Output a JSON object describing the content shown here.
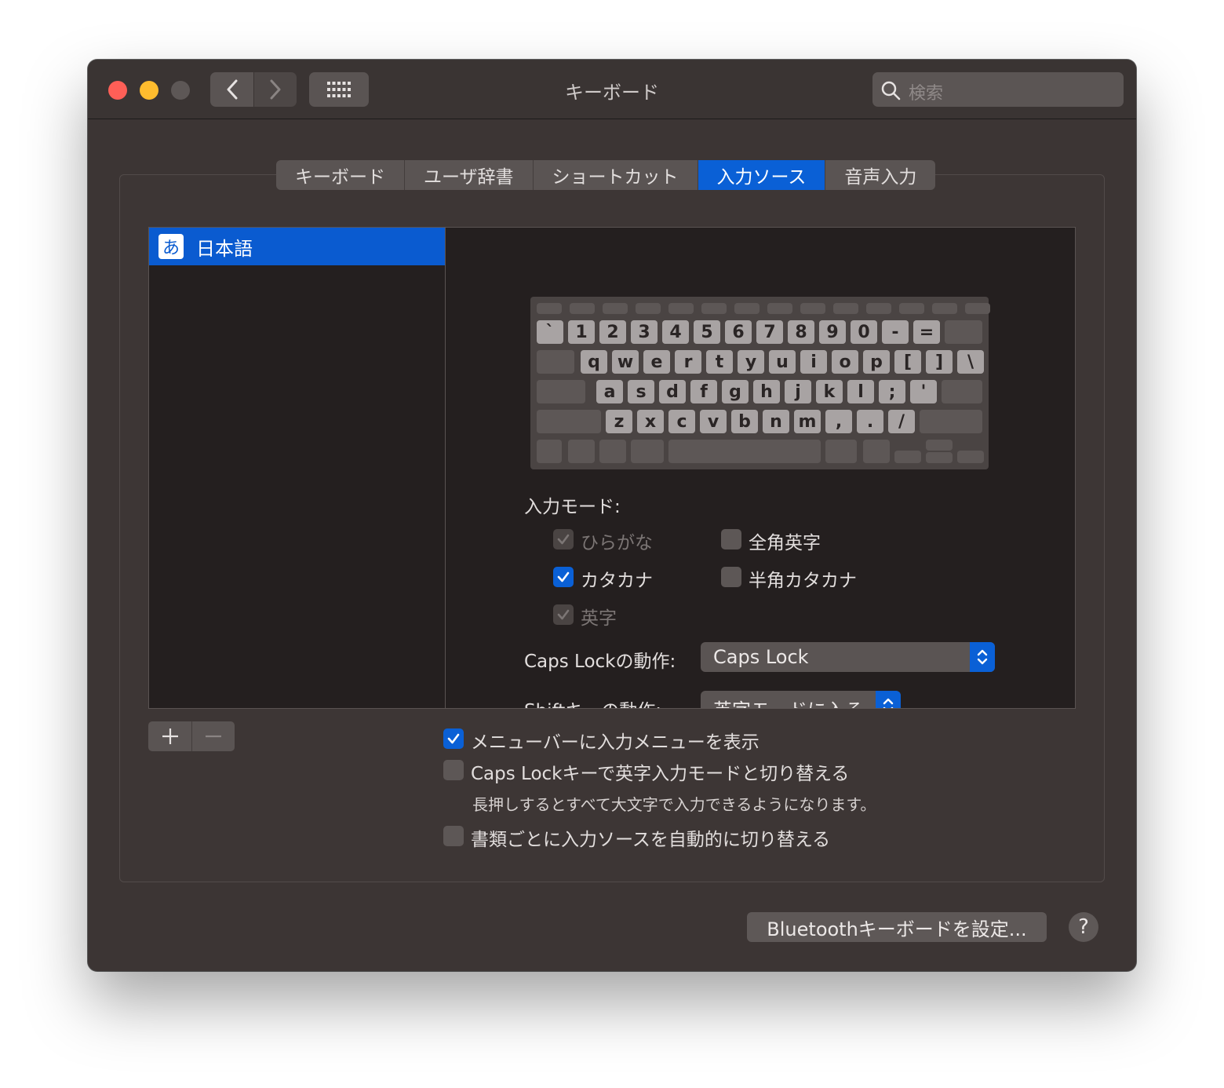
{
  "window": {
    "title": "キーボード"
  },
  "search": {
    "placeholder": "検索"
  },
  "tabs": [
    {
      "label": "キーボード"
    },
    {
      "label": "ユーザ辞書"
    },
    {
      "label": "ショートカット"
    },
    {
      "label": "入力ソース",
      "active": true
    },
    {
      "label": "音声入力"
    }
  ],
  "source_list": {
    "items": [
      {
        "icon_text": "あ",
        "label": "日本語",
        "selected": true
      }
    ]
  },
  "keyboard_rows": [
    [
      "`",
      "1",
      "2",
      "3",
      "4",
      "5",
      "6",
      "7",
      "8",
      "9",
      "0",
      "-",
      "="
    ],
    [
      "q",
      "w",
      "e",
      "r",
      "t",
      "y",
      "u",
      "i",
      "o",
      "p",
      "[",
      "]",
      "\\"
    ],
    [
      "a",
      "s",
      "d",
      "f",
      "g",
      "h",
      "j",
      "k",
      "l",
      ";",
      "'"
    ],
    [
      "z",
      "x",
      "c",
      "v",
      "b",
      "n",
      "m",
      ",",
      ".",
      "/"
    ]
  ],
  "input_mode": {
    "label": "入力モード:",
    "options": [
      {
        "label": "ひらがな",
        "checked": true,
        "disabled": true
      },
      {
        "label": "全角英字",
        "checked": false,
        "disabled": false
      },
      {
        "label": "カタカナ",
        "checked": true,
        "disabled": false
      },
      {
        "label": "半角カタカナ",
        "checked": false,
        "disabled": false
      },
      {
        "label": "英字",
        "checked": true,
        "disabled": true
      }
    ]
  },
  "caps_lock": {
    "label": "Caps Lockの動作:",
    "value": "Caps Lock"
  },
  "shift": {
    "label": "Shiftキーの動作:",
    "value": "英字モードに入る"
  },
  "options": {
    "menu_bar": {
      "label": "メニューバーに入力メニューを表示",
      "checked": true
    },
    "caps_switch": {
      "label": "Caps Lockキーで英字入力モードと切り替える",
      "checked": false
    },
    "caps_note": "長押しするとすべて大文字で入力できるようになります。",
    "auto_switch": {
      "label": "書類ごとに入力ソースを自動的に切り替える",
      "checked": false
    }
  },
  "buttons": {
    "bluetooth": "Bluetoothキーボードを設定...",
    "help": "?"
  },
  "colors": {
    "accent": "#0a60d6",
    "window_bg": "#3c3534",
    "list_bg": "#241f1f"
  }
}
